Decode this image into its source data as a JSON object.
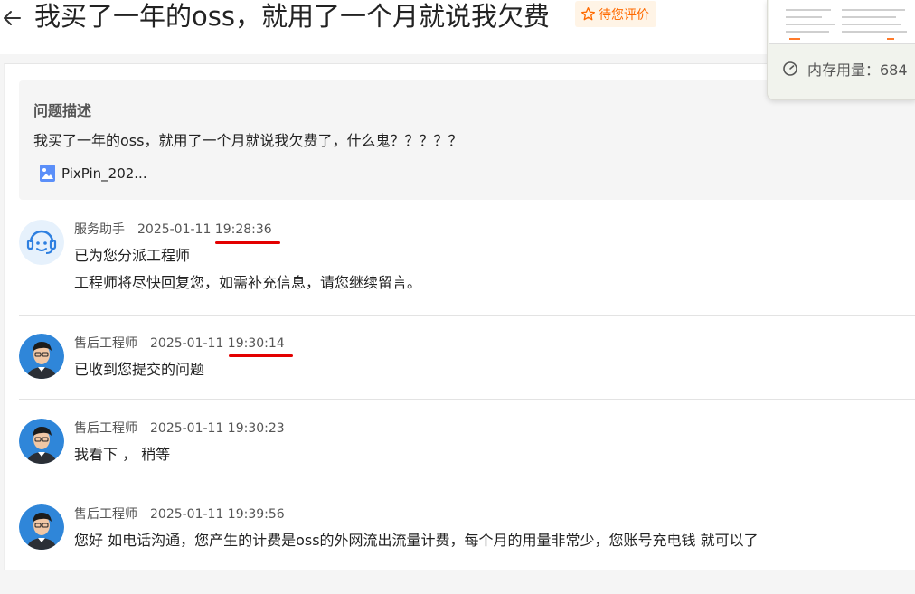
{
  "header": {
    "title": "我买了一年的oss，就用了一个月就说我欠费",
    "rate_label": "待您评价",
    "accent_color": "#ff6a00",
    "back_icon": "arrow-left-icon"
  },
  "overlay": {
    "memory_label": "内存用量：684"
  },
  "description": {
    "label": "问题描述",
    "text": "我买了一年的oss，就用了一个月就说我欠费了，什么鬼？？？？？",
    "attachment_name": "PixPin_202..."
  },
  "messages": [
    {
      "sender": "服务助手",
      "datetime": "2025-01-11 19:28:36",
      "lines": [
        "已为您分派工程师",
        "工程师将尽快回复您，如需补充信息，请您继续留言。"
      ],
      "avatar": "robot-avatar"
    },
    {
      "sender": "售后工程师",
      "datetime": "2025-01-11 19:30:14",
      "lines": [
        "已收到您提交的问题"
      ],
      "avatar": "engineer-avatar"
    },
    {
      "sender": "售后工程师",
      "datetime": "2025-01-11 19:30:23",
      "lines": [
        "我看下 ， 稍等"
      ],
      "avatar": "engineer-avatar"
    },
    {
      "sender": "售后工程师",
      "datetime": "2025-01-11 19:39:56",
      "lines": [
        "您好 如电话沟通，您产生的计费是oss的外网流出流量计费，每个月的用量非常少，您账号充电钱 就可以了"
      ],
      "avatar": "engineer-avatar"
    }
  ],
  "annotation_color": "#e30000"
}
